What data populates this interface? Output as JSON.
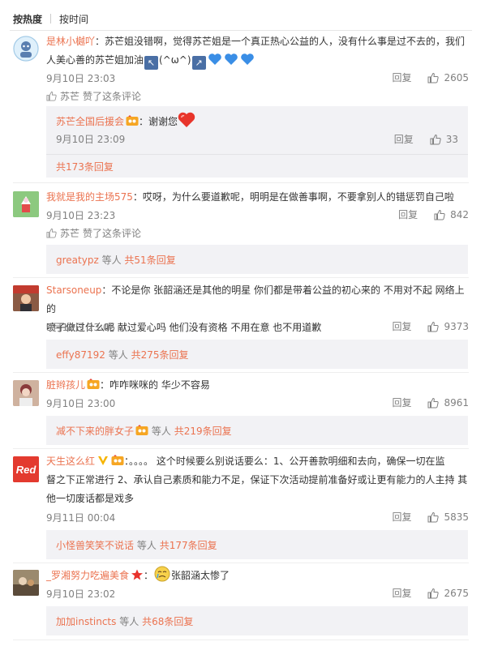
{
  "tabs": {
    "hot": "按热度",
    "time": "按时间"
  },
  "like_label": "赞了这条评论",
  "reply_label": "回复",
  "more_suffix": "等人",
  "comments": [
    {
      "user": "是林小樾吖",
      "text_a": "：苏芒姐没错啊，觉得苏芒姐是一个真正热心公益的人，没有什么事是过不去的，我们",
      "text_b": "人美心善的苏芒姐加油",
      "text_c": "(^ω^)",
      "time": "9月10日 23:03",
      "likes": "2605",
      "liked_by": "苏芒",
      "sub": {
        "user": "苏芒全国后援会",
        "text": "：谢谢您",
        "time": "9月10日 23:09",
        "likes": "33",
        "more": "共173条回复"
      }
    },
    {
      "user": "我就是我的主场575",
      "text": "：哎呀，为什么要道歉呢，明明是在做善事啊，不要拿别人的错惩罚自己啦",
      "time": "9月10日 23:23",
      "likes": "842",
      "liked_by": "苏芒",
      "more_name": "greatypz",
      "more_count": "共51条回复"
    },
    {
      "user": "Starsoneup",
      "text_a": "：不论是你 张韶涵还是其他的明星 你们都是带着公益的初心来的 不用对不起 网络上的",
      "text_b": "喷子做过什么呢 献过爱心吗 他们没有资格 不用在意 也不用道歉",
      "time": "9月10日 23:05",
      "likes": "9373",
      "more_name": "effy87192",
      "more_count": "共275条回复"
    },
    {
      "user": "脏辫孩儿",
      "text": "：咋咋咪咪的 华少不容易",
      "time": "9月10日 23:00",
      "likes": "8961",
      "more_name": "减不下来的胖女子",
      "more_count": "共219条回复"
    },
    {
      "user": "天生这么红",
      "text_a": "：。。。。 这个时候要么别说话要么：1、公开善款明细和去向，确保一切在监",
      "text_b": "督之下正常进行 2、承认自己素质和能力不足，保证下次活动提前准备好或让更有能力的人主持 其",
      "text_c": "他一切废话都是戏多",
      "time": "9月11日 00:04",
      "likes": "5835",
      "more_name": "小怪兽笑笑不说话",
      "more_count": "共177条回复"
    },
    {
      "user": "_罗湘努力吃遍美食",
      "text": "张韶涵太惨了",
      "time": "9月10日 23:02",
      "likes": "2675",
      "more_name": "加加instincts",
      "more_count": "共68条回复"
    }
  ]
}
